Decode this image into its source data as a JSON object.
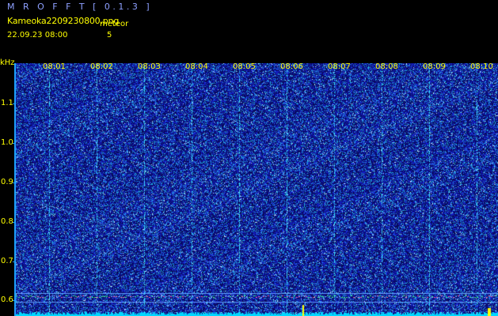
{
  "header": {
    "app_title": "M R O F F T [ 0.1.3 ]",
    "file_name": "Kameoka2209230800.png",
    "meteor_label": "meteor",
    "date_time": "22.09.23 08:00",
    "meteor_count": "5"
  },
  "axis": {
    "unit_label": "kHz",
    "y_ticks": [
      "1.1",
      "1.0",
      "0.9",
      "0.8",
      "0.7",
      "0.6"
    ],
    "x_ticks": [
      "08:01",
      "08:02",
      "08:03",
      "08:04",
      "08:05",
      "08:06",
      "08:07",
      "08:08",
      "08:09",
      "08:10"
    ]
  },
  "colors": {
    "background": "#000000",
    "noise_dark": "#0a0a6e",
    "label": "#ffff00",
    "axis": "#1ea0ff",
    "signal": "#00e6ff"
  }
}
